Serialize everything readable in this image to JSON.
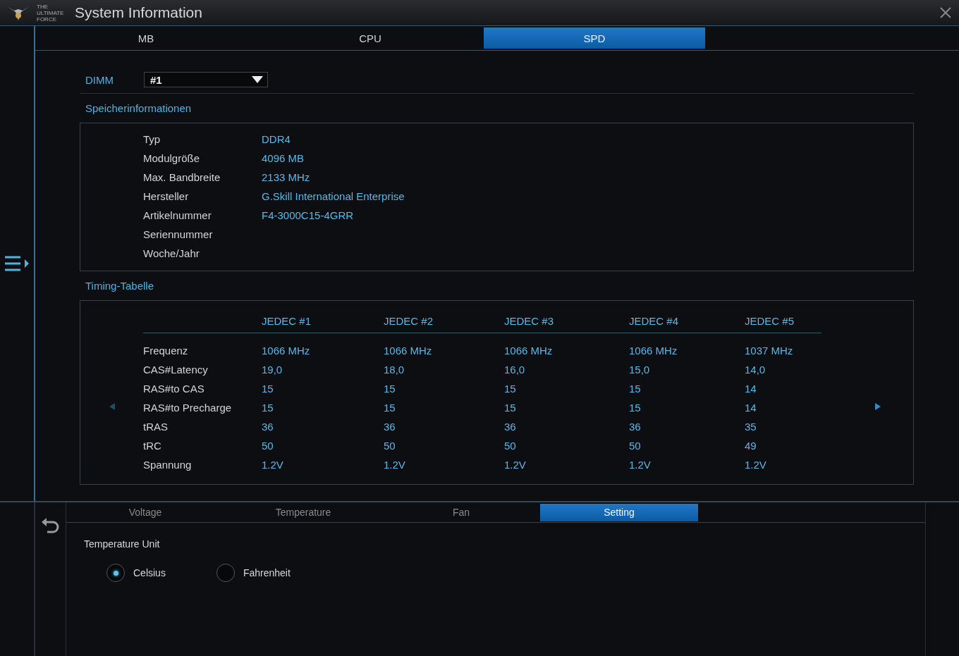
{
  "window": {
    "title": "System Information",
    "logo_text": "THE ULTIMATE FORCE"
  },
  "tabs": [
    {
      "label": "MB",
      "selected": false
    },
    {
      "label": "CPU",
      "selected": false
    },
    {
      "label": "SPD",
      "selected": true
    }
  ],
  "dimm": {
    "label": "DIMM",
    "value": "#1"
  },
  "memory_info": {
    "title": "Speicherinformationen",
    "rows": [
      {
        "label": "Typ",
        "value": "DDR4"
      },
      {
        "label": "Modulgröße",
        "value": "4096 MB"
      },
      {
        "label": "Max. Bandbreite",
        "value": "2133 MHz"
      },
      {
        "label": "Hersteller",
        "value": "G.Skill International Enterprise"
      },
      {
        "label": "Artikelnummer",
        "value": "F4-3000C15-4GRR"
      },
      {
        "label": "Seriennummer"
      },
      {
        "label": "Woche/Jahr"
      }
    ]
  },
  "timing_table": {
    "title": "Timing-Tabelle",
    "columns": [
      "JEDEC #1",
      "JEDEC #2",
      "JEDEC #3",
      "JEDEC #4",
      "JEDEC #5"
    ],
    "rows": [
      {
        "label": "Frequenz",
        "values": [
          "1066 MHz",
          "1066 MHz",
          "1066 MHz",
          "1066 MHz",
          "1037 MHz"
        ]
      },
      {
        "label": "CAS#Latency",
        "values": [
          "19,0",
          "18,0",
          "16,0",
          "15,0",
          "14,0"
        ]
      },
      {
        "label": "RAS#to CAS",
        "values": [
          "15",
          "15",
          "15",
          "15",
          "14"
        ]
      },
      {
        "label": "RAS#to Precharge",
        "values": [
          "15",
          "15",
          "15",
          "15",
          "14"
        ]
      },
      {
        "label": "tRAS",
        "values": [
          "36",
          "36",
          "36",
          "36",
          "35"
        ]
      },
      {
        "label": "tRC",
        "values": [
          "50",
          "50",
          "50",
          "50",
          "49"
        ]
      },
      {
        "label": "Spannung",
        "values": [
          "1.2V",
          "1.2V",
          "1.2V",
          "1.2V",
          "1.2V"
        ]
      }
    ]
  },
  "bottom_tabs": [
    {
      "label": "Voltage",
      "selected": false
    },
    {
      "label": "Temperature",
      "selected": false
    },
    {
      "label": "Fan",
      "selected": false
    },
    {
      "label": "Setting",
      "selected": true
    }
  ],
  "temperature_unit": {
    "label": "Temperature Unit",
    "options": [
      {
        "label": "Celsius",
        "selected": true
      },
      {
        "label": "Fahrenheit",
        "selected": false
      }
    ]
  }
}
